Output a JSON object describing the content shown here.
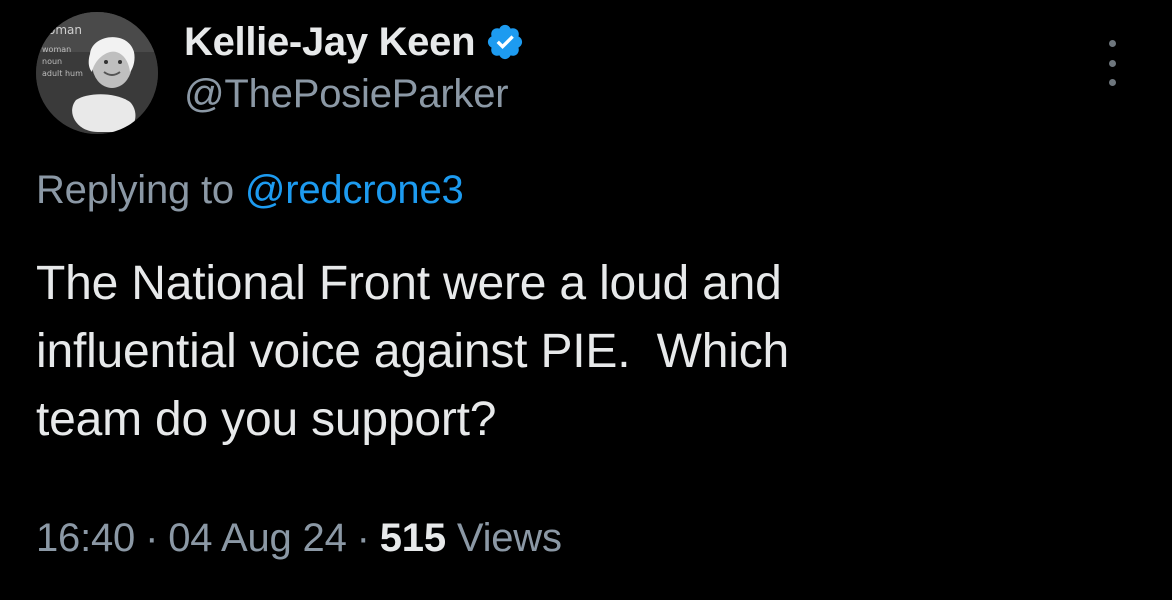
{
  "author": {
    "display_name": "Kellie-Jay Keen",
    "handle": "@ThePosieParker",
    "verified": true,
    "verified_icon": "verified-badge-icon",
    "avatar": "profile-avatar"
  },
  "more_menu": {
    "icon": "more-vertical-icon"
  },
  "reply_context": {
    "prefix": "Replying to",
    "mention": "@redcrone3"
  },
  "tweet": {
    "text": "The National Front were a loud and\ninfluential voice against PIE.  Which\nteam do you support?"
  },
  "meta": {
    "time": "16:40",
    "date": "04 Aug 24",
    "separator": "·",
    "views_count": "515",
    "views_label": "Views"
  },
  "colors": {
    "background": "#000000",
    "primary_text": "#e7e9ea",
    "secondary_text": "#8b98a5",
    "accent": "#1d9bf0"
  }
}
